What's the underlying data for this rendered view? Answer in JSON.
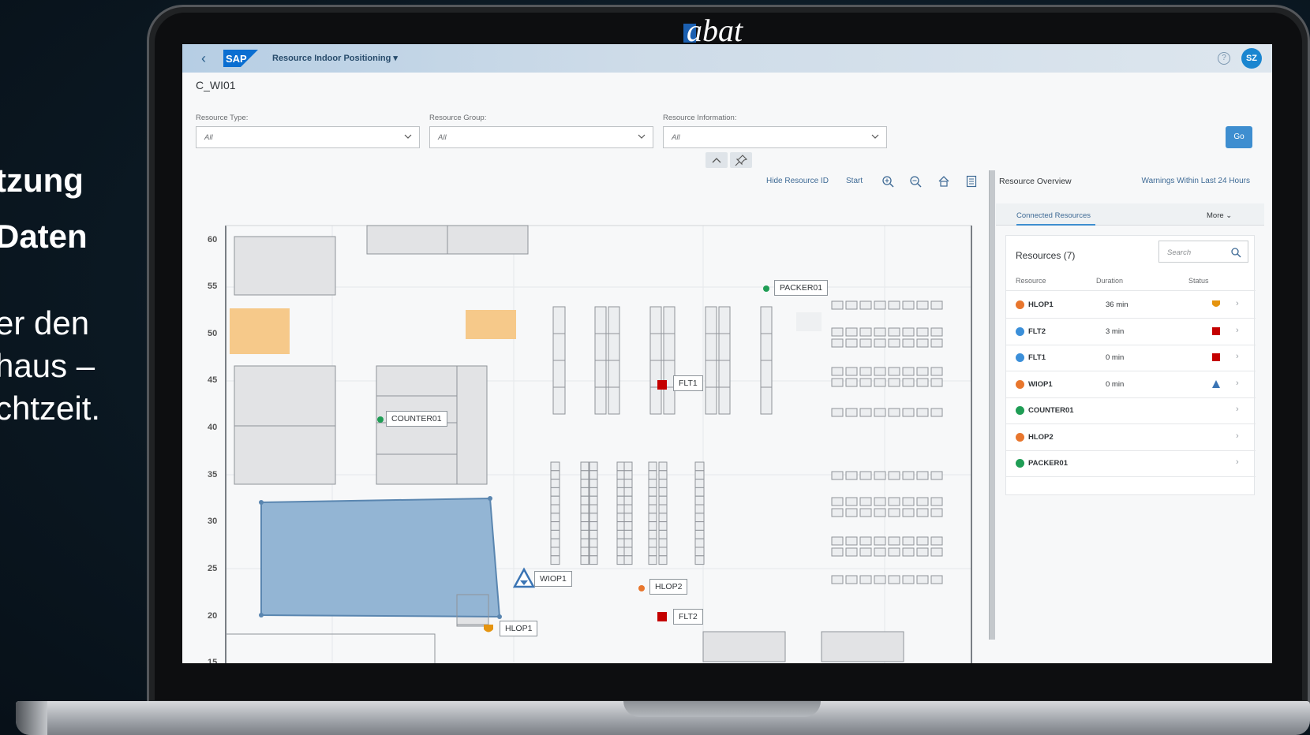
{
  "slide": {
    "lines": [
      {
        "text": "tzung",
        "bold": true
      },
      {
        "text": " Daten",
        "bold": true
      },
      {
        "text": "er den",
        "bold": false
      },
      {
        "text": "haus –",
        "bold": false
      },
      {
        "text": "chtzeit.",
        "bold": false
      }
    ]
  },
  "laptop_brand": "abat",
  "shell": {
    "app_title": "Resource Indoor Positioning",
    "help_icon": "help-icon",
    "avatar_initials": "SZ"
  },
  "page": {
    "title": "C_WI01"
  },
  "filters": [
    {
      "label": "Resource Type:",
      "value": "All"
    },
    {
      "label": "Resource Group:",
      "value": "All"
    },
    {
      "label": "Resource Information:",
      "value": "All"
    }
  ],
  "go_label": "Go",
  "map_toolbar": {
    "hide_id": "Hide Resource ID",
    "start": "Start",
    "icons": [
      "zoom-in-icon",
      "zoom-out-icon",
      "home-icon",
      "legend-icon"
    ]
  },
  "map": {
    "y_ticks": [
      "60",
      "55",
      "50",
      "45",
      "40",
      "35",
      "30",
      "25",
      "20",
      "15"
    ],
    "resources": [
      {
        "id": "PACKER01",
        "marker": "green-dot"
      },
      {
        "id": "FLT1",
        "marker": "red-square"
      },
      {
        "id": "COUNTER01",
        "marker": "green-dot"
      },
      {
        "id": "WIOP1",
        "marker": "blue-triangle"
      },
      {
        "id": "HLOP2",
        "marker": "orange-dot"
      },
      {
        "id": "FLT2",
        "marker": "red-square"
      },
      {
        "id": "HLOP1",
        "marker": "orange-shield"
      }
    ]
  },
  "panel": {
    "title": "Resource Overview",
    "warnings_link": "Warnings Within Last 24 Hours",
    "tab_active": "Connected Resources",
    "tab_more": "More",
    "table_title": "Resources  (7)",
    "search_placeholder": "Search",
    "columns": [
      "Resource",
      "Duration",
      "Status"
    ],
    "rows": [
      {
        "name": "HLOP1",
        "duration": "36 min",
        "dot": "#e8762d",
        "status": "shield-orange"
      },
      {
        "name": "FLT2",
        "duration": "3 min",
        "dot": "#3b8fd9",
        "status": "square-red"
      },
      {
        "name": "FLT1",
        "duration": "0 min",
        "dot": "#3b8fd9",
        "status": "square-red"
      },
      {
        "name": "WIOP1",
        "duration": "0 min",
        "dot": "#e8762d",
        "status": "triangle-blue"
      },
      {
        "name": "COUNTER01",
        "duration": "",
        "dot": "#1f9d55",
        "status": ""
      },
      {
        "name": "HLOP2",
        "duration": "",
        "dot": "#e8762d",
        "status": ""
      },
      {
        "name": "PACKER01",
        "duration": "",
        "dot": "#1f9d55",
        "status": ""
      }
    ]
  },
  "colors": {
    "accent": "#3e8ed0",
    "shell": "#cddbe8",
    "status_red": "#c40000",
    "status_orange": "#e5940f",
    "status_blue": "#3a74b4",
    "zone_blue": "#93b5d4",
    "zone_orange": "#f6c98a"
  }
}
